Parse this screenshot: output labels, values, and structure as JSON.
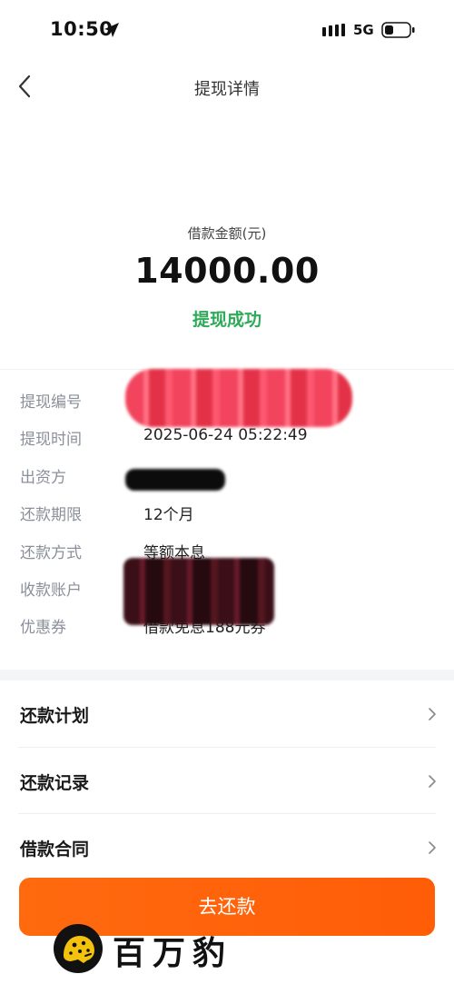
{
  "status_bar": {
    "time": "10:50",
    "network": "5G"
  },
  "nav": {
    "title": "提现详情"
  },
  "summary": {
    "amount_label": "借款金额(元)",
    "amount": "14000.00",
    "status": "提现成功",
    "status_color": "#2eaa59"
  },
  "details": [
    {
      "label": "提现编号",
      "value": ""
    },
    {
      "label": "提现时间",
      "value": "2025-06-24 05:22:49"
    },
    {
      "label": "出资方",
      "value": ""
    },
    {
      "label": "还款期限",
      "value": "12个月"
    },
    {
      "label": "还款方式",
      "value": "等额本息"
    },
    {
      "label": "收款账户",
      "value": ""
    },
    {
      "label": "优惠券",
      "value": "借款免息188元券"
    }
  ],
  "menu": [
    {
      "label": "还款计划"
    },
    {
      "label": "还款记录"
    },
    {
      "label": "借款合同"
    }
  ],
  "cta": {
    "label": "去还款",
    "color": "#ff6208"
  },
  "watermark": {
    "text": "百万豹"
  },
  "icons": {
    "back": "chevron-left-icon",
    "menu_arrow": "chevron-right-icon",
    "location": "location-arrow-icon",
    "signal": "signal-icon",
    "battery": "battery-icon",
    "logo": "leopard-logo-icon"
  }
}
